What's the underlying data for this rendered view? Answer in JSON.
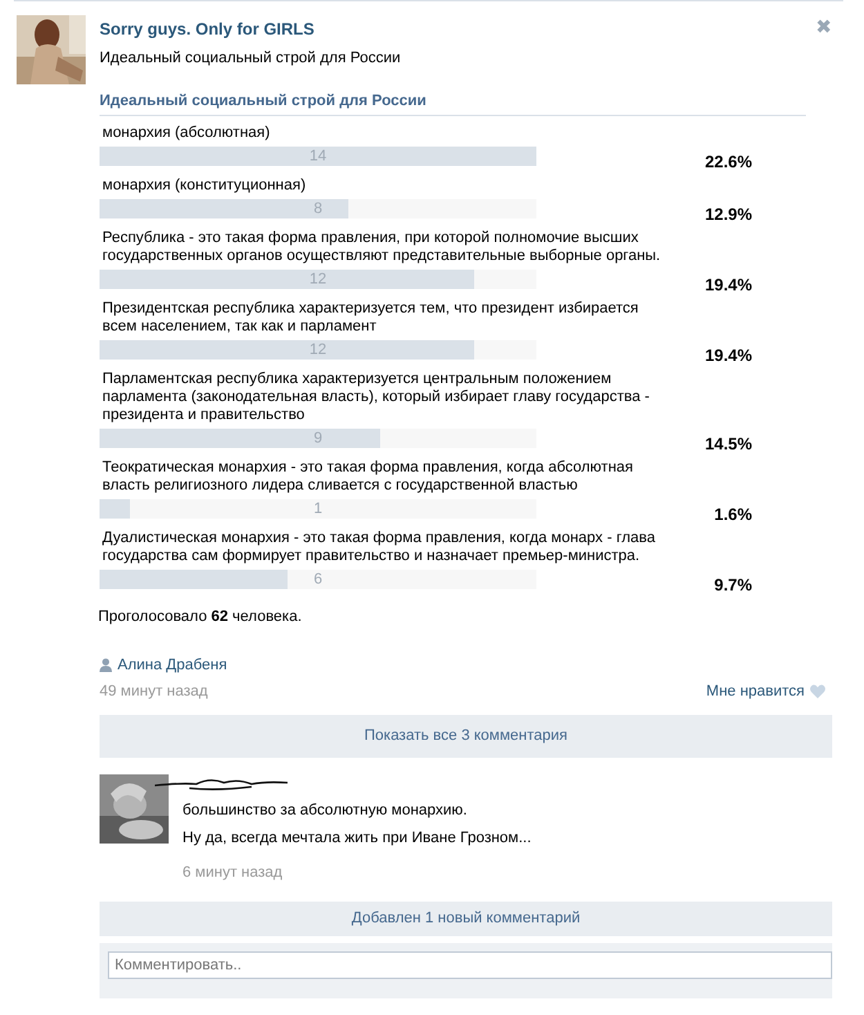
{
  "post": {
    "author": "Sorry guys. Only for GIRLS",
    "text": "Идеальный социальный строй для России",
    "close": "✖"
  },
  "poll": {
    "title": "Идеальный социальный строй для России",
    "options": [
      {
        "label": "монархия (абсолютная)",
        "count": "14",
        "level": 1,
        "percent": "22.6%"
      },
      {
        "label": "монархия (конституционная)",
        "count": "8",
        "level": 0.571,
        "percent": "12.9%"
      },
      {
        "label": "Республика - это такая форма правления, при которой полномочие высших государственных органов осуществляют представительные выборные органы.",
        "count": "12",
        "level": 0.857,
        "percent": "19.4%"
      },
      {
        "label": "Президентская республика характеризуется тем, что президент избирается всем населением, так как и парламент",
        "count": "12",
        "level": 0.857,
        "percent": "19.4%"
      },
      {
        "label": "Парламентская республика характеризуется центральным положением парламента (законодательная власть), который избирает главу государства - президента и правительство",
        "count": "9",
        "level": 0.643,
        "percent": "14.5%"
      },
      {
        "label": "Теократическая монархия - это такая форма правления, когда абсолютная власть религиозного лидера сливается с государственной властью",
        "count": "1",
        "level": 0.071,
        "percent": "1.6%"
      },
      {
        "label": "Дуалистическая монархия - это такая форма правления, когда монарх - глава государства сам формирует правительство и назначает премьер-министра.",
        "count": "6",
        "level": 0.429,
        "percent": "9.7%"
      }
    ],
    "total": "Проголосовало **62** человека."
  },
  "signer": "Алина Драбеня",
  "time": "49 минут назад",
  "like": "Мне нравится",
  "show_comments": "Показать все 3 комментария",
  "comments": [
    {
      "lines": [
        "большинство за абсолютную монархию.",
        "Ну да, всегда мечтала жить при Иване Грозном..."
      ],
      "time": "6 минут назад"
    }
  ],
  "new_comments": "Добавлен 1 новый комментарий",
  "comment_field": {
    "placeholder": "Комментировать.."
  }
}
